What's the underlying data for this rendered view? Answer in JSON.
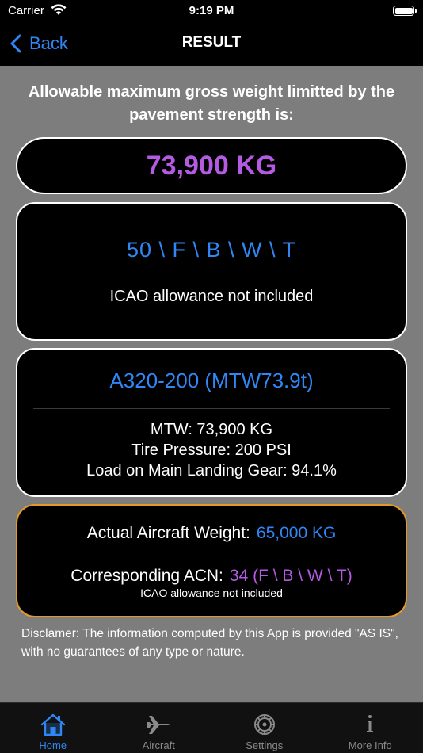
{
  "status_bar": {
    "carrier": "Carrier",
    "time": "9:19 PM"
  },
  "nav": {
    "back_label": "Back",
    "title": "RESULT"
  },
  "intro_text": "Allowable maximum gross weight limitted by the pavement strength is:",
  "max_weight": "73,900 KG",
  "pcn": {
    "code": "50 \\ F \\ B \\ W \\ T",
    "note": "ICAO allowance not included"
  },
  "aircraft": {
    "name": "A320-200 (MTW73.9t)",
    "mtw": "MTW: 73,900 KG",
    "tire_pressure": "Tire Pressure: 200 PSI",
    "mlg_load": "Load on Main Landing Gear: 94.1%"
  },
  "result": {
    "weight_label": "Actual Aircraft Weight:",
    "weight_value": "65,000 KG",
    "acn_label": "Corresponding ACN:",
    "acn_value": "34 (F \\ B \\ W \\ T)",
    "acn_note": "ICAO allowance not included"
  },
  "disclaimer": "Disclamer: The information computed by this App is provided \"AS IS\", with no guarantees of any type or nature.",
  "tabs": [
    {
      "label": "Home",
      "icon": "home-icon",
      "active": true
    },
    {
      "label": "Aircraft",
      "icon": "airplane-icon",
      "active": false
    },
    {
      "label": "Settings",
      "icon": "gear-icon",
      "active": false
    },
    {
      "label": "More Info",
      "icon": "info-icon",
      "active": false
    }
  ],
  "colors": {
    "accent_blue": "#2f87f5",
    "accent_purple": "#b55ae3",
    "highlight_orange": "#e69a26",
    "background": "#7d7d7d"
  }
}
